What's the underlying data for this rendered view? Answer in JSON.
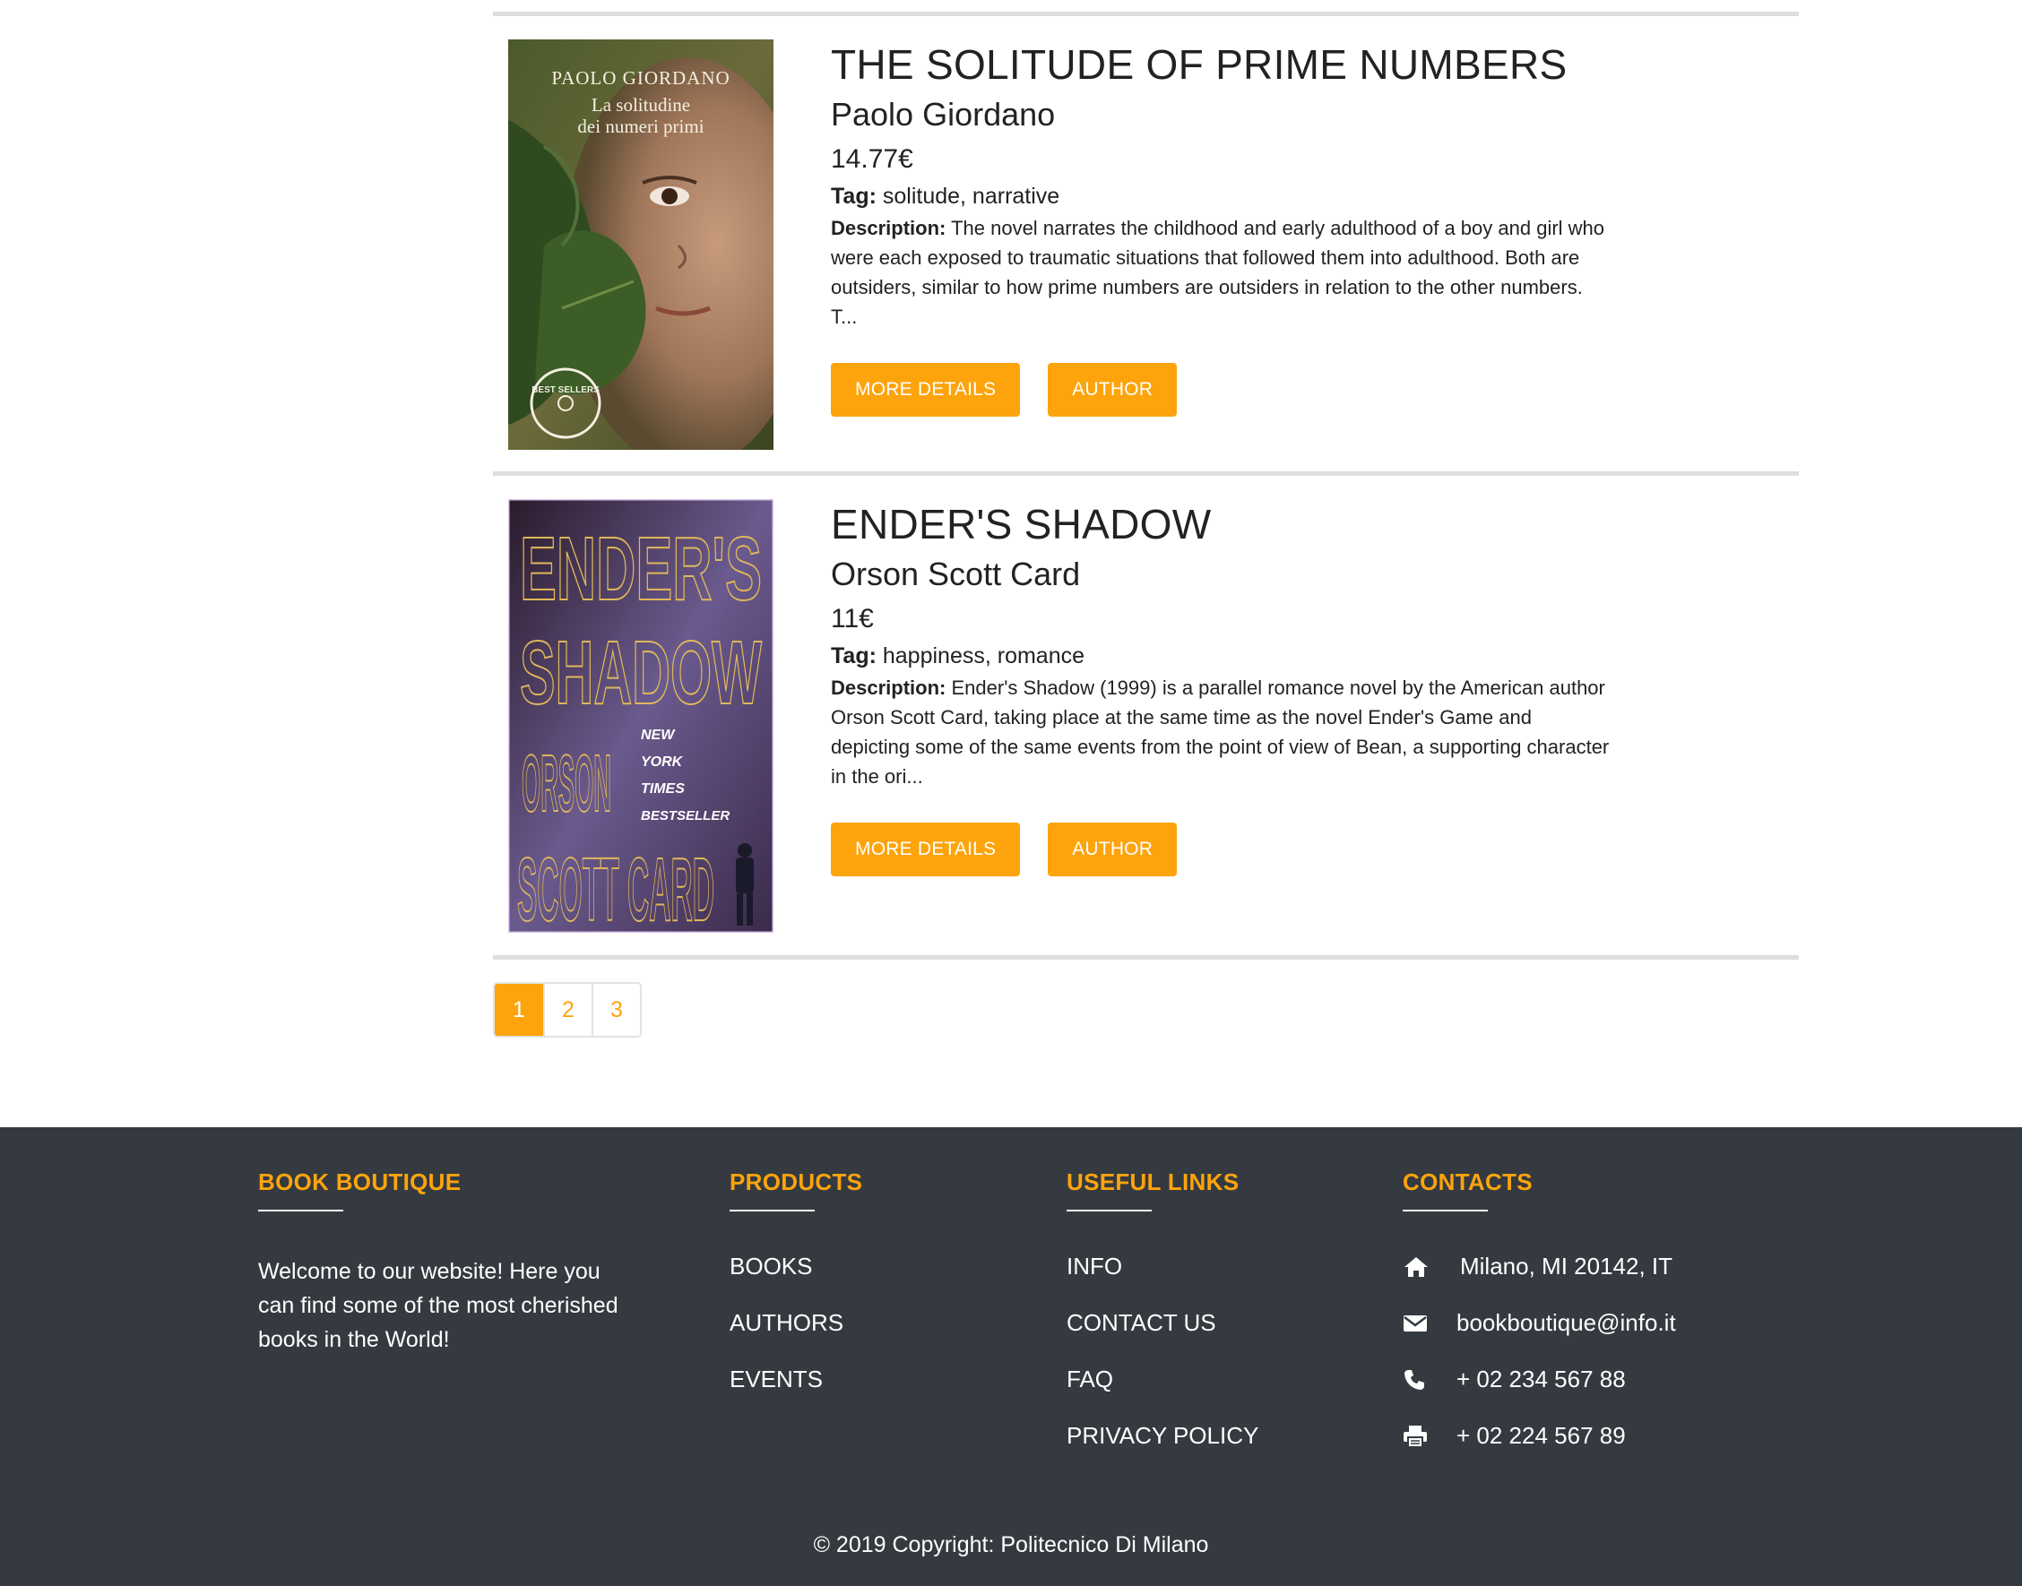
{
  "books": [
    {
      "title": "THE SOLITUDE OF PRIME NUMBERS",
      "author": "Paolo Giordano",
      "price": "14.77€",
      "tag_label": "Tag:",
      "tags": "solitude, narrative",
      "description_label": "Description:",
      "description": "The novel narrates the childhood and early adulthood of a boy and girl who were each exposed to traumatic situations that followed them into adulthood. Both are outsiders, similar to how prime numbers are outsiders in relation to the other numbers. T...",
      "cover_author": "PAOLO GIORDANO",
      "cover_title_line1": "La solitudine",
      "cover_title_line2": "dei numeri primi",
      "cover_badge": "BEST SELLERS",
      "more_details_label": "MORE DETAILS",
      "author_button_label": "AUTHOR"
    },
    {
      "title": "ENDER'S SHADOW",
      "author": "Orson Scott Card",
      "price": "11€",
      "tag_label": "Tag:",
      "tags": "happiness, romance",
      "description_label": "Description:",
      "description": "Ender's Shadow (1999) is a parallel romance novel by the American author Orson Scott Card, taking place at the same time as the novel Ender's Game and depicting some of the same events from the point of view of Bean, a supporting character in the ori...",
      "cover_title_line1": "ENDER'S",
      "cover_title_line2": "SHADOW",
      "cover_author_line1": "ORSON",
      "cover_author_line2": "SCOTT CARD",
      "cover_badge_line1": "NEW",
      "cover_badge_line2": "YORK",
      "cover_badge_line3": "TIMES",
      "cover_badge_line4": "BESTSELLER",
      "more_details_label": "MORE DETAILS",
      "author_button_label": "AUTHOR"
    }
  ],
  "pagination": {
    "pages": [
      "1",
      "2",
      "3"
    ],
    "active": "1"
  },
  "footer": {
    "about": {
      "heading": "BOOK BOUTIQUE",
      "text": "Welcome to our website! Here you can find some of the most cherished books in the World!"
    },
    "products": {
      "heading": "PRODUCTS",
      "links": [
        "BOOKS",
        "AUTHORS",
        "EVENTS"
      ]
    },
    "useful_links": {
      "heading": "USEFUL LINKS",
      "links": [
        "INFO",
        "CONTACT US",
        "FAQ",
        "PRIVACY POLICY"
      ]
    },
    "contacts": {
      "heading": "CONTACTS",
      "address": "Milano, MI 20142, IT",
      "email": "bookboutique@info.it",
      "phone": "+ 02 234 567 88",
      "fax": "+ 02 224 567 89",
      "icons": [
        "home-icon",
        "envelope-icon",
        "phone-icon",
        "print-icon"
      ]
    },
    "copyright": "© 2019 Copyright: Politecnico Di Milano"
  },
  "colors": {
    "accent": "#fda40c",
    "footer_bg": "#343a40",
    "divider": "#dedede"
  }
}
